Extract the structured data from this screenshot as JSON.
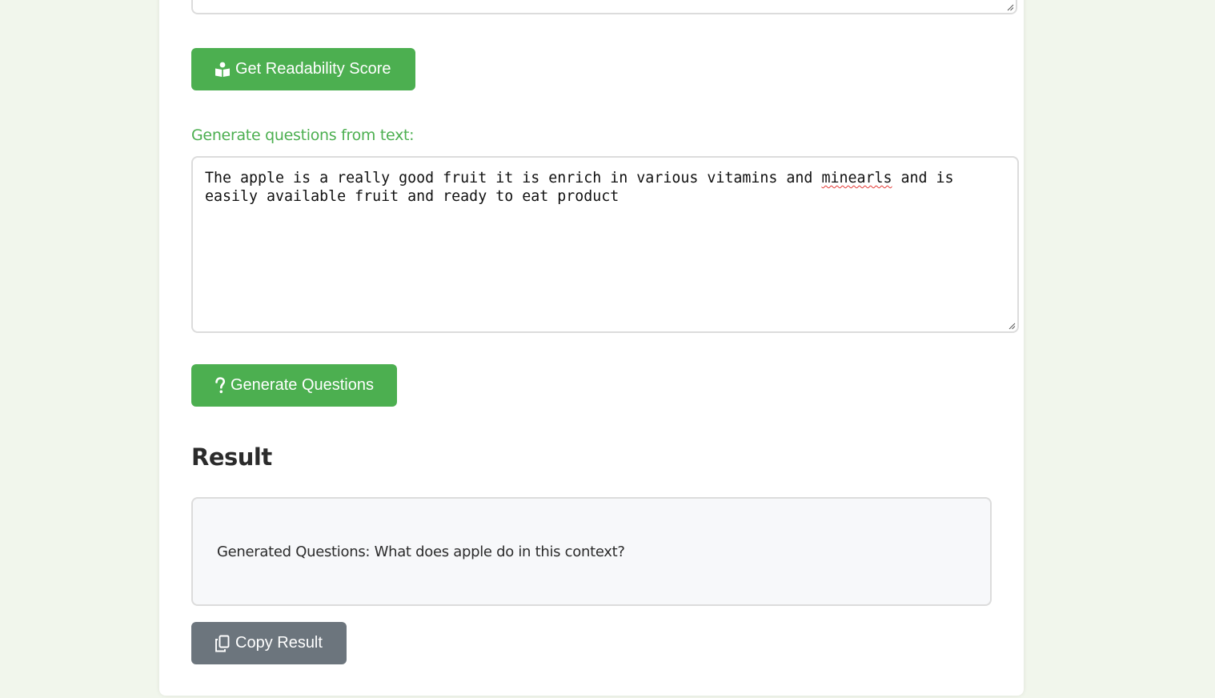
{
  "readability": {
    "button_label": "Get Readability Score",
    "icon": "book-reader-icon"
  },
  "questions": {
    "section_label": "Generate questions from text:",
    "input_text_before": "The apple is a really good fruit it is enrich in various vitamins and ",
    "input_text_misspelled": "minearls",
    "input_text_after": " and is\neasily available fruit and ready to eat product",
    "button_label": "Generate Questions",
    "icon": "question-mark-icon"
  },
  "result": {
    "heading": "Result",
    "text": "Generated Questions: What does apple do in this context?",
    "copy_button_label": "Copy Result",
    "copy_icon": "copy-icon"
  },
  "colors": {
    "background": "#f1f6ec",
    "accent_green": "#4caf50",
    "copy_gray": "#6c757d",
    "result_box_bg": "#f7f8fa"
  }
}
